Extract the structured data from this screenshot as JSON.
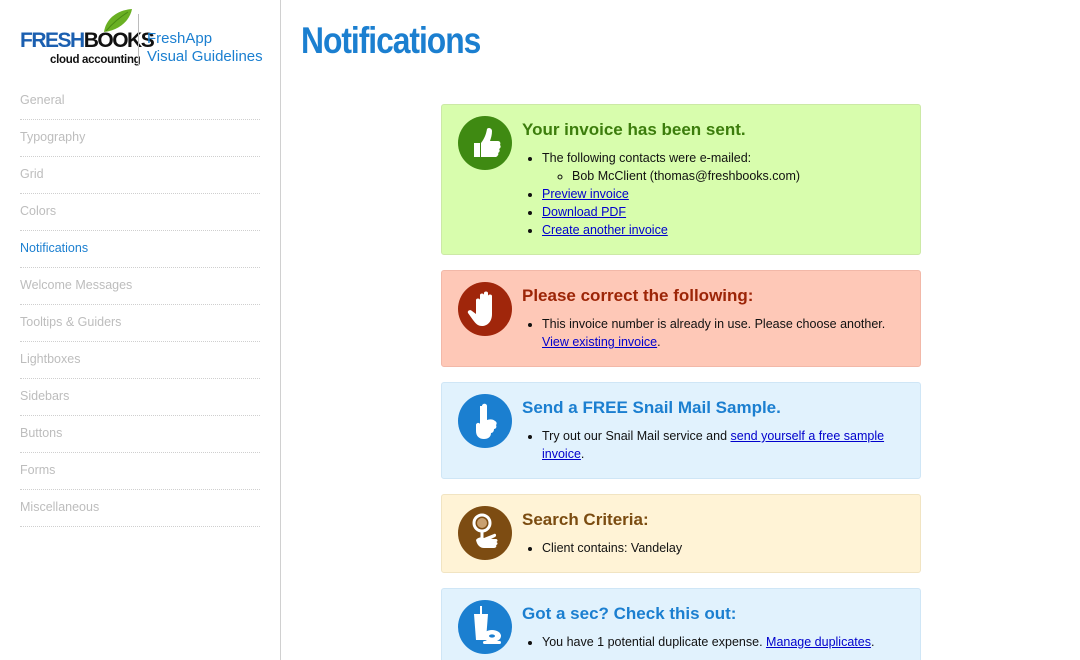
{
  "brand": {
    "logo_fresh": "FRESH",
    "logo_books": "BOOKS",
    "logo_sub": "cloud accounting",
    "app_name": "FreshApp",
    "app_subtitle": "Visual Guidelines"
  },
  "sidebar": {
    "items": [
      {
        "label": "General"
      },
      {
        "label": "Typography"
      },
      {
        "label": "Grid"
      },
      {
        "label": "Colors"
      },
      {
        "label": "Notifications",
        "active": true
      },
      {
        "label": "Welcome Messages"
      },
      {
        "label": "Tooltips & Guiders"
      },
      {
        "label": "Lightboxes"
      },
      {
        "label": "Sidebars"
      },
      {
        "label": "Buttons"
      },
      {
        "label": "Forms"
      },
      {
        "label": "Miscellaneous"
      }
    ]
  },
  "page": {
    "title": "Notifications"
  },
  "notifications": {
    "success": {
      "icon": "thumbs-up-icon",
      "title": "Your invoice has been sent.",
      "contacts_text": "The following contacts were e-mailed:",
      "contact": "Bob McClient (thomas@freshbooks.com)",
      "link_preview": "Preview invoice",
      "link_download": "Download PDF",
      "link_create": "Create another invoice"
    },
    "error": {
      "icon": "raised-hand-icon",
      "title": "Please correct the following:",
      "text": "This invoice number is already in use. Please choose another. ",
      "link": "View existing invoice",
      "after": "."
    },
    "info": {
      "icon": "pointing-finger-icon",
      "title": "Send a FREE Snail Mail Sample.",
      "text": "Try out our Snail Mail service and ",
      "link": "send yourself a free sample invoice",
      "after": "."
    },
    "search": {
      "icon": "magnifying-glass-icon",
      "title": "Search Criteria:",
      "text": "Client contains: Vandelay"
    },
    "tip": {
      "icon": "coffee-donut-icon",
      "title": "Got a sec? Check this out:",
      "text": "You have 1 potential duplicate expense. ",
      "link": "Manage duplicates",
      "after": "."
    }
  },
  "colors": {
    "accent": "#1b7fd0",
    "success_bg": "#d8fdad",
    "error_bg": "#fec8b7",
    "info_bg": "#e1f2fd",
    "search_bg": "#fff3d6"
  }
}
